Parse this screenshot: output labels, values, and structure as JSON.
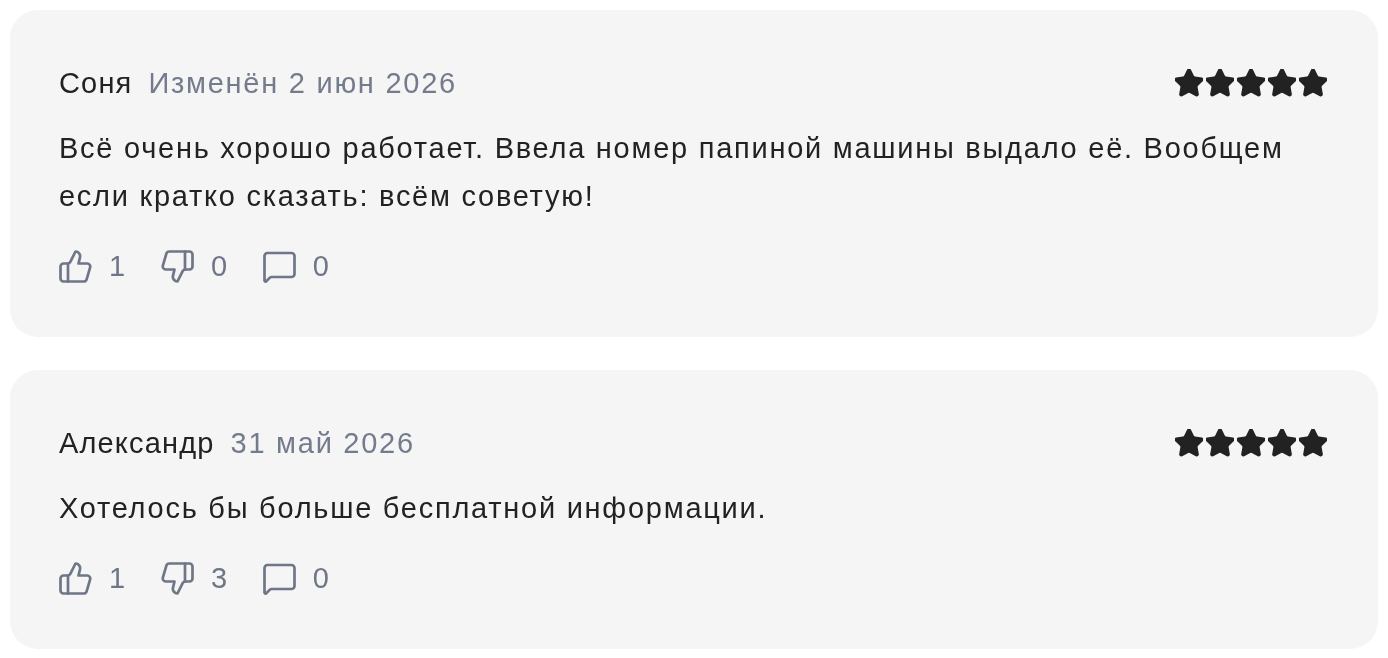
{
  "reviews": [
    {
      "author": "Соня",
      "date": "Изменён 2 июн 2026",
      "stars": 5,
      "text": "Всё очень хорошо работает. Ввела номер папиной машины выдало её. Вообщем если кратко сказать: всём советую!",
      "likes": "1",
      "dislikes": "0",
      "comments": "0"
    },
    {
      "author": "Александр",
      "date": "31 май 2026",
      "stars": 5,
      "text": "Хотелось бы больше бесплатной информации.",
      "likes": "1",
      "dislikes": "3",
      "comments": "0"
    }
  ]
}
